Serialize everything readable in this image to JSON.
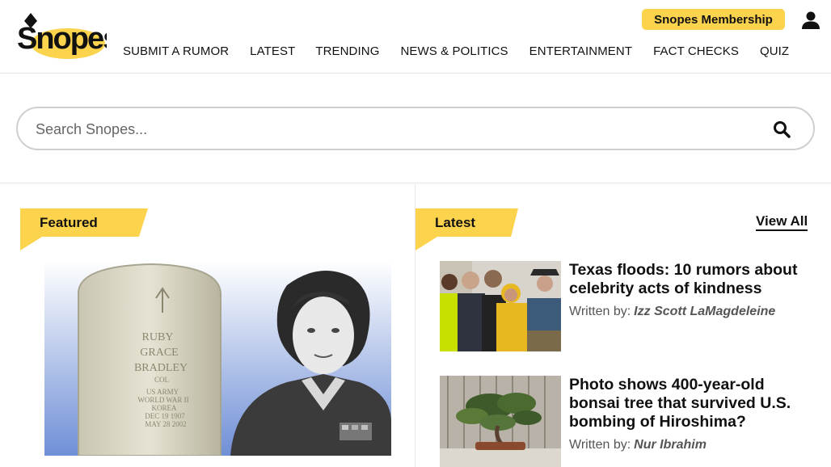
{
  "header": {
    "logo_text": "Snopes",
    "membership_label": "Snopes Membership",
    "nav": [
      {
        "label": "SUBMIT A RUMOR"
      },
      {
        "label": "LATEST"
      },
      {
        "label": "TRENDING"
      },
      {
        "label": "NEWS & POLITICS"
      },
      {
        "label": "ENTERTAINMENT"
      },
      {
        "label": "FACT CHECKS"
      },
      {
        "label": "QUIZ"
      }
    ]
  },
  "search": {
    "placeholder": "Search Snopes..."
  },
  "featured": {
    "label": "Featured",
    "headstone_lines": [
      "RUBY",
      "GRACE",
      "BRADLEY",
      "COL",
      "US ARMY",
      "WORLD WAR II",
      "KOREA",
      "DEC 19 1907",
      "MAY 28 2002"
    ]
  },
  "latest": {
    "label": "Latest",
    "view_all_label": "View All",
    "articles": [
      {
        "title": "Texas floods: 10 rumors about celebrity acts of kindness",
        "written_by_label": "Written by:",
        "author": "Izz Scott LaMagdeleine"
      },
      {
        "title": "Photo shows 400-year-old bonsai tree that survived U.S. bombing of Hiroshima?",
        "written_by_label": "Written by:",
        "author": "Nur Ibrahim"
      }
    ]
  },
  "colors": {
    "accent": "#fcd34d",
    "text": "#111111",
    "muted": "#555555"
  }
}
